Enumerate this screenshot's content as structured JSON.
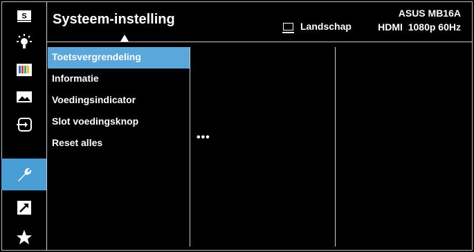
{
  "header": {
    "title": "Systeem-instelling",
    "model": "ASUS MB16A",
    "mode_label": "Landschap",
    "signal": "HDMI  1080p 60Hz"
  },
  "sidebar": {
    "items": [
      {
        "icon": "splendid-icon",
        "glyph": "S"
      },
      {
        "icon": "blue-light-filter-icon"
      },
      {
        "icon": "color-icon"
      },
      {
        "icon": "image-icon"
      },
      {
        "icon": "input-select-icon"
      },
      {
        "icon": "system-setup-icon",
        "active": true
      },
      {
        "icon": "shortcut-icon"
      },
      {
        "icon": "myfavorite-icon"
      }
    ]
  },
  "menu": {
    "items": [
      {
        "label": "Toetsvergrendeling",
        "selected": true
      },
      {
        "label": "Informatie"
      },
      {
        "label": "Voedingsindicator"
      },
      {
        "label": "Slot voedingsknop"
      },
      {
        "label": "Reset alles"
      }
    ],
    "more": "•••"
  },
  "colors": {
    "accent": "#4a9ed6",
    "selection": "#5aa7dc",
    "background": "#000000"
  }
}
